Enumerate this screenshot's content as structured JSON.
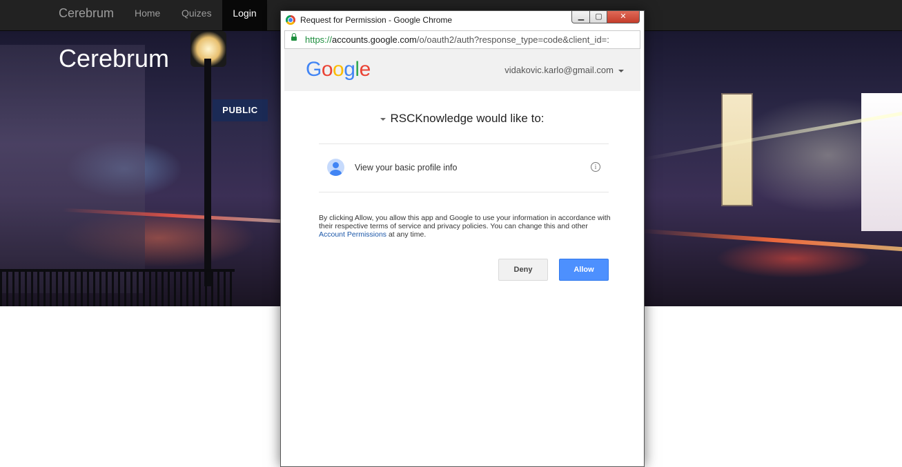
{
  "navbar": {
    "brand": "Cerebrum",
    "links": [
      {
        "label": "Home"
      },
      {
        "label": "Quizes"
      },
      {
        "label": "Login",
        "active": true
      }
    ]
  },
  "hero": {
    "title": "Cerebrum",
    "sign_text": "PUBLIC"
  },
  "popup": {
    "window_title": "Request for Permission - Google Chrome",
    "window_buttons": {
      "minimize": "▁",
      "maximize": "▢",
      "close": "✕"
    },
    "address": {
      "scheme": "https://",
      "host": "accounts.google.com",
      "path": "/o/oauth2/auth?response_type=code&client_id=:"
    },
    "consent": {
      "logo_letters": [
        "G",
        "o",
        "o",
        "g",
        "l",
        "e"
      ],
      "account_email": "vidakovic.karlo@gmail.com",
      "request_title": "RSCKnowledge would like to:",
      "scopes": [
        {
          "label": "View your basic profile info",
          "icon": "person-icon"
        }
      ],
      "legal_before": "By clicking Allow, you allow this app and Google to use your information in accordance with their respective terms of service and privacy policies. You can change this and other ",
      "legal_link": "Account Permissions",
      "legal_after": " at any time.",
      "deny_label": "Deny",
      "allow_label": "Allow"
    }
  },
  "colors": {
    "navbar_bg": "#222222",
    "allow_button": "#4d90fe",
    "link": "#1a56a8"
  }
}
